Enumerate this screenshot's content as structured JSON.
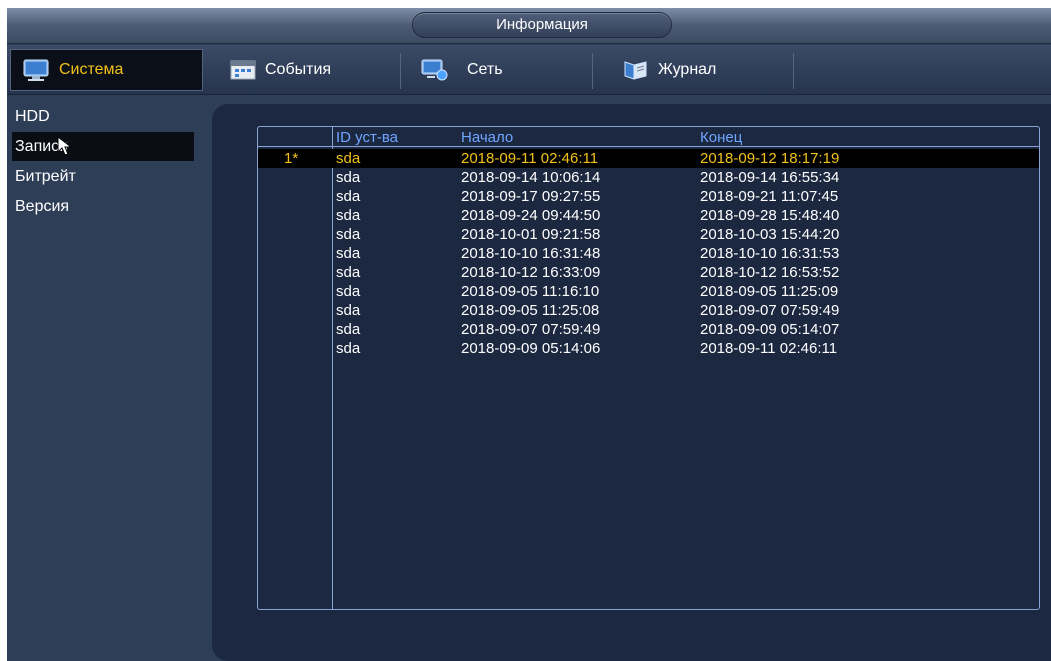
{
  "window": {
    "title": "Информация"
  },
  "tabs": [
    {
      "label": "Система",
      "icon": "monitor-icon",
      "active": true
    },
    {
      "label": "События",
      "icon": "events-icon",
      "active": false
    },
    {
      "label": "Сеть",
      "icon": "network-icon",
      "active": false
    },
    {
      "label": "Журнал",
      "icon": "journal-icon",
      "active": false
    }
  ],
  "sidebar": {
    "items": [
      {
        "label": "HDD"
      },
      {
        "label": "Записи"
      },
      {
        "label": "Битрейт"
      },
      {
        "label": "Версия"
      }
    ],
    "active_index": 1
  },
  "table": {
    "columns": [
      "",
      "ID уст-ва",
      "Начало",
      "Конец"
    ],
    "rows": [
      {
        "index": "1*",
        "device": "sda",
        "start": "2018-09-11 02:46:11",
        "end": "2018-09-12 18:17:19",
        "selected": true
      },
      {
        "index": "",
        "device": "sda",
        "start": "2018-09-14 10:06:14",
        "end": "2018-09-14 16:55:34"
      },
      {
        "index": "",
        "device": "sda",
        "start": "2018-09-17 09:27:55",
        "end": "2018-09-21 11:07:45"
      },
      {
        "index": "",
        "device": "sda",
        "start": "2018-09-24 09:44:50",
        "end": "2018-09-28 15:48:40"
      },
      {
        "index": "",
        "device": "sda",
        "start": "2018-10-01 09:21:58",
        "end": "2018-10-03 15:44:20"
      },
      {
        "index": "",
        "device": "sda",
        "start": "2018-10-10 16:31:48",
        "end": "2018-10-10 16:31:53"
      },
      {
        "index": "",
        "device": "sda",
        "start": "2018-10-12 16:33:09",
        "end": "2018-10-12 16:53:52"
      },
      {
        "index": "",
        "device": "sda",
        "start": "2018-09-05 11:16:10",
        "end": "2018-09-05 11:25:09"
      },
      {
        "index": "",
        "device": "sda",
        "start": "2018-09-05 11:25:08",
        "end": "2018-09-07 07:59:49"
      },
      {
        "index": "",
        "device": "sda",
        "start": "2018-09-07 07:59:49",
        "end": "2018-09-09 05:14:07"
      },
      {
        "index": "",
        "device": "sda",
        "start": "2018-09-09 05:14:06",
        "end": "2018-09-11 02:46:11"
      }
    ]
  },
  "colors": {
    "accent": "#f2c21a",
    "header_text": "#6ea6ff",
    "panel": "#1c2740",
    "background": "#2f3e57"
  }
}
